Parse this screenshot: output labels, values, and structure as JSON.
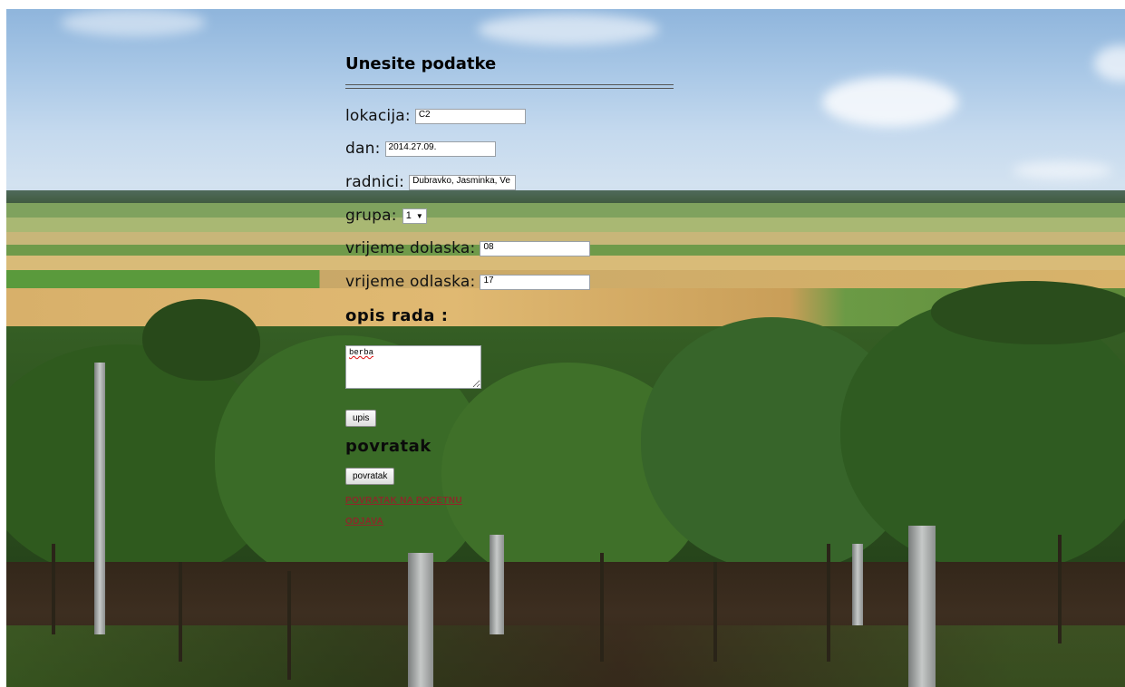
{
  "form": {
    "heading": "Unesite podatke",
    "fields": {
      "lokacija": {
        "label": "lokacija:",
        "value": "C2"
      },
      "dan": {
        "label": "dan:",
        "value": "2014.27.09."
      },
      "radnici": {
        "label": "radnici:",
        "value": "Dubravko, Jasminka, Ve"
      },
      "grupa": {
        "label": "grupa:",
        "selected": "1"
      },
      "dolazak": {
        "label": "vrijeme dolaska:",
        "value": "08"
      },
      "odlazak": {
        "label": "vrijeme odlaska:",
        "value": "17"
      }
    },
    "opis_heading": "opis rada :",
    "opis_value": "berba",
    "submit_label": "upis",
    "povratak_heading": "povratak",
    "povratak_button": "povratak",
    "link_home": "POVRATAK NA POCETNU",
    "link_logout": "ODJAVA"
  },
  "background": {
    "description_icon": "vineyard-landscape-image",
    "colors": {
      "sky": "#a8c7e6",
      "fields": "#d9b46c",
      "vines": "#3f6b26",
      "soil": "#3b2c1f"
    }
  }
}
